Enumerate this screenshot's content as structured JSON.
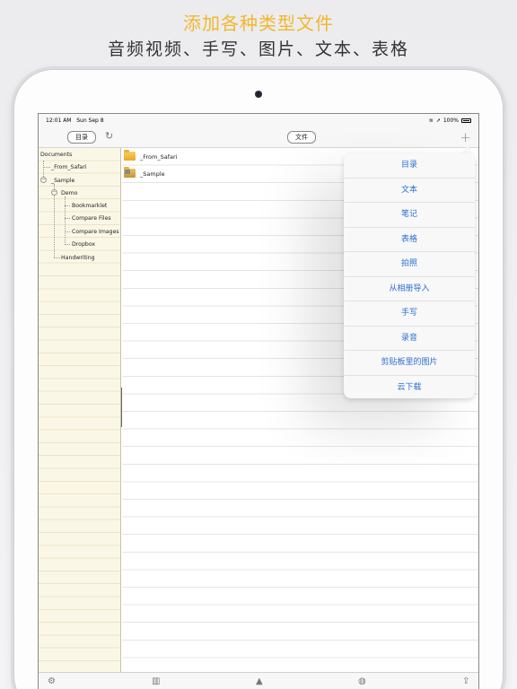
{
  "promo": {
    "title": "添加各种类型文件",
    "subtitle": "音频视频、手写、图片、文本、表格"
  },
  "statusbar": {
    "time": "12:01 AM",
    "date": "Sun Sep 8",
    "battery_text": "100%"
  },
  "navbar": {
    "directory_button": "目录",
    "file_button": "文件",
    "refresh_icon": "refresh-icon",
    "add_icon": "plus-icon"
  },
  "sidebar": {
    "root": "Documents",
    "items": [
      {
        "label": "_From_Safari"
      },
      {
        "label": "_Sample"
      },
      {
        "label": "Demo"
      },
      {
        "label": "Bookmarklet"
      },
      {
        "label": "Compare Files"
      },
      {
        "label": "Compare Images"
      },
      {
        "label": "Dropbox"
      },
      {
        "label": "Handwriting"
      }
    ]
  },
  "filelist": {
    "items": [
      {
        "name": "_From_Safari",
        "icon": "folder-icon"
      },
      {
        "name": "_Sample",
        "icon": "folder-icon"
      }
    ]
  },
  "menu": {
    "items": [
      {
        "label": "目录"
      },
      {
        "label": "文本"
      },
      {
        "label": "笔记"
      },
      {
        "label": "表格"
      },
      {
        "label": "拍照"
      },
      {
        "label": "从相册导入"
      },
      {
        "label": "手写"
      },
      {
        "label": "录音"
      },
      {
        "label": "剪贴板里的图片"
      },
      {
        "label": "云下载"
      }
    ]
  },
  "toolbar": {
    "icons": [
      "gear-icon",
      "books-icon",
      "tree-icon",
      "globe-icon",
      "share-icon"
    ]
  },
  "colors": {
    "promo_title": "#f1b72e",
    "menu_text": "#2a6fd6",
    "sidebar_bg": "#fbf7e7"
  }
}
